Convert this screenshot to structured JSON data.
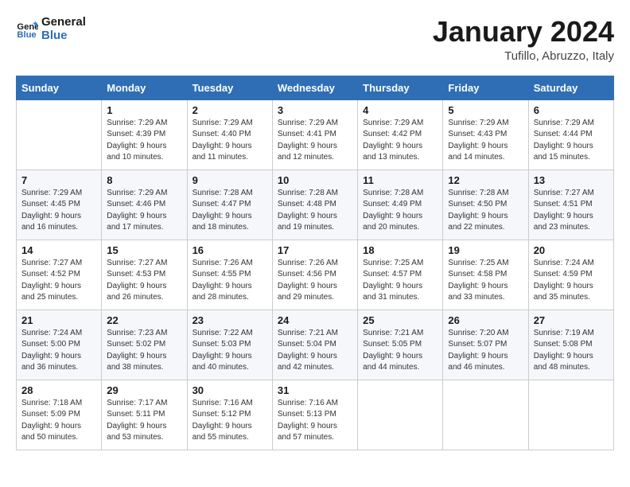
{
  "header": {
    "logo_text_general": "General",
    "logo_text_blue": "Blue",
    "month_year": "January 2024",
    "location": "Tufillo, Abruzzo, Italy"
  },
  "weekdays": [
    "Sunday",
    "Monday",
    "Tuesday",
    "Wednesday",
    "Thursday",
    "Friday",
    "Saturday"
  ],
  "weeks": [
    [
      {
        "day": "",
        "sunrise": "",
        "sunset": "",
        "daylight": ""
      },
      {
        "day": "1",
        "sunrise": "Sunrise: 7:29 AM",
        "sunset": "Sunset: 4:39 PM",
        "daylight": "Daylight: 9 hours and 10 minutes."
      },
      {
        "day": "2",
        "sunrise": "Sunrise: 7:29 AM",
        "sunset": "Sunset: 4:40 PM",
        "daylight": "Daylight: 9 hours and 11 minutes."
      },
      {
        "day": "3",
        "sunrise": "Sunrise: 7:29 AM",
        "sunset": "Sunset: 4:41 PM",
        "daylight": "Daylight: 9 hours and 12 minutes."
      },
      {
        "day": "4",
        "sunrise": "Sunrise: 7:29 AM",
        "sunset": "Sunset: 4:42 PM",
        "daylight": "Daylight: 9 hours and 13 minutes."
      },
      {
        "day": "5",
        "sunrise": "Sunrise: 7:29 AM",
        "sunset": "Sunset: 4:43 PM",
        "daylight": "Daylight: 9 hours and 14 minutes."
      },
      {
        "day": "6",
        "sunrise": "Sunrise: 7:29 AM",
        "sunset": "Sunset: 4:44 PM",
        "daylight": "Daylight: 9 hours and 15 minutes."
      }
    ],
    [
      {
        "day": "7",
        "sunrise": "Sunrise: 7:29 AM",
        "sunset": "Sunset: 4:45 PM",
        "daylight": "Daylight: 9 hours and 16 minutes."
      },
      {
        "day": "8",
        "sunrise": "Sunrise: 7:29 AM",
        "sunset": "Sunset: 4:46 PM",
        "daylight": "Daylight: 9 hours and 17 minutes."
      },
      {
        "day": "9",
        "sunrise": "Sunrise: 7:28 AM",
        "sunset": "Sunset: 4:47 PM",
        "daylight": "Daylight: 9 hours and 18 minutes."
      },
      {
        "day": "10",
        "sunrise": "Sunrise: 7:28 AM",
        "sunset": "Sunset: 4:48 PM",
        "daylight": "Daylight: 9 hours and 19 minutes."
      },
      {
        "day": "11",
        "sunrise": "Sunrise: 7:28 AM",
        "sunset": "Sunset: 4:49 PM",
        "daylight": "Daylight: 9 hours and 20 minutes."
      },
      {
        "day": "12",
        "sunrise": "Sunrise: 7:28 AM",
        "sunset": "Sunset: 4:50 PM",
        "daylight": "Daylight: 9 hours and 22 minutes."
      },
      {
        "day": "13",
        "sunrise": "Sunrise: 7:27 AM",
        "sunset": "Sunset: 4:51 PM",
        "daylight": "Daylight: 9 hours and 23 minutes."
      }
    ],
    [
      {
        "day": "14",
        "sunrise": "Sunrise: 7:27 AM",
        "sunset": "Sunset: 4:52 PM",
        "daylight": "Daylight: 9 hours and 25 minutes."
      },
      {
        "day": "15",
        "sunrise": "Sunrise: 7:27 AM",
        "sunset": "Sunset: 4:53 PM",
        "daylight": "Daylight: 9 hours and 26 minutes."
      },
      {
        "day": "16",
        "sunrise": "Sunrise: 7:26 AM",
        "sunset": "Sunset: 4:55 PM",
        "daylight": "Daylight: 9 hours and 28 minutes."
      },
      {
        "day": "17",
        "sunrise": "Sunrise: 7:26 AM",
        "sunset": "Sunset: 4:56 PM",
        "daylight": "Daylight: 9 hours and 29 minutes."
      },
      {
        "day": "18",
        "sunrise": "Sunrise: 7:25 AM",
        "sunset": "Sunset: 4:57 PM",
        "daylight": "Daylight: 9 hours and 31 minutes."
      },
      {
        "day": "19",
        "sunrise": "Sunrise: 7:25 AM",
        "sunset": "Sunset: 4:58 PM",
        "daylight": "Daylight: 9 hours and 33 minutes."
      },
      {
        "day": "20",
        "sunrise": "Sunrise: 7:24 AM",
        "sunset": "Sunset: 4:59 PM",
        "daylight": "Daylight: 9 hours and 35 minutes."
      }
    ],
    [
      {
        "day": "21",
        "sunrise": "Sunrise: 7:24 AM",
        "sunset": "Sunset: 5:00 PM",
        "daylight": "Daylight: 9 hours and 36 minutes."
      },
      {
        "day": "22",
        "sunrise": "Sunrise: 7:23 AM",
        "sunset": "Sunset: 5:02 PM",
        "daylight": "Daylight: 9 hours and 38 minutes."
      },
      {
        "day": "23",
        "sunrise": "Sunrise: 7:22 AM",
        "sunset": "Sunset: 5:03 PM",
        "daylight": "Daylight: 9 hours and 40 minutes."
      },
      {
        "day": "24",
        "sunrise": "Sunrise: 7:21 AM",
        "sunset": "Sunset: 5:04 PM",
        "daylight": "Daylight: 9 hours and 42 minutes."
      },
      {
        "day": "25",
        "sunrise": "Sunrise: 7:21 AM",
        "sunset": "Sunset: 5:05 PM",
        "daylight": "Daylight: 9 hours and 44 minutes."
      },
      {
        "day": "26",
        "sunrise": "Sunrise: 7:20 AM",
        "sunset": "Sunset: 5:07 PM",
        "daylight": "Daylight: 9 hours and 46 minutes."
      },
      {
        "day": "27",
        "sunrise": "Sunrise: 7:19 AM",
        "sunset": "Sunset: 5:08 PM",
        "daylight": "Daylight: 9 hours and 48 minutes."
      }
    ],
    [
      {
        "day": "28",
        "sunrise": "Sunrise: 7:18 AM",
        "sunset": "Sunset: 5:09 PM",
        "daylight": "Daylight: 9 hours and 50 minutes."
      },
      {
        "day": "29",
        "sunrise": "Sunrise: 7:17 AM",
        "sunset": "Sunset: 5:11 PM",
        "daylight": "Daylight: 9 hours and 53 minutes."
      },
      {
        "day": "30",
        "sunrise": "Sunrise: 7:16 AM",
        "sunset": "Sunset: 5:12 PM",
        "daylight": "Daylight: 9 hours and 55 minutes."
      },
      {
        "day": "31",
        "sunrise": "Sunrise: 7:16 AM",
        "sunset": "Sunset: 5:13 PM",
        "daylight": "Daylight: 9 hours and 57 minutes."
      },
      {
        "day": "",
        "sunrise": "",
        "sunset": "",
        "daylight": ""
      },
      {
        "day": "",
        "sunrise": "",
        "sunset": "",
        "daylight": ""
      },
      {
        "day": "",
        "sunrise": "",
        "sunset": "",
        "daylight": ""
      }
    ]
  ]
}
